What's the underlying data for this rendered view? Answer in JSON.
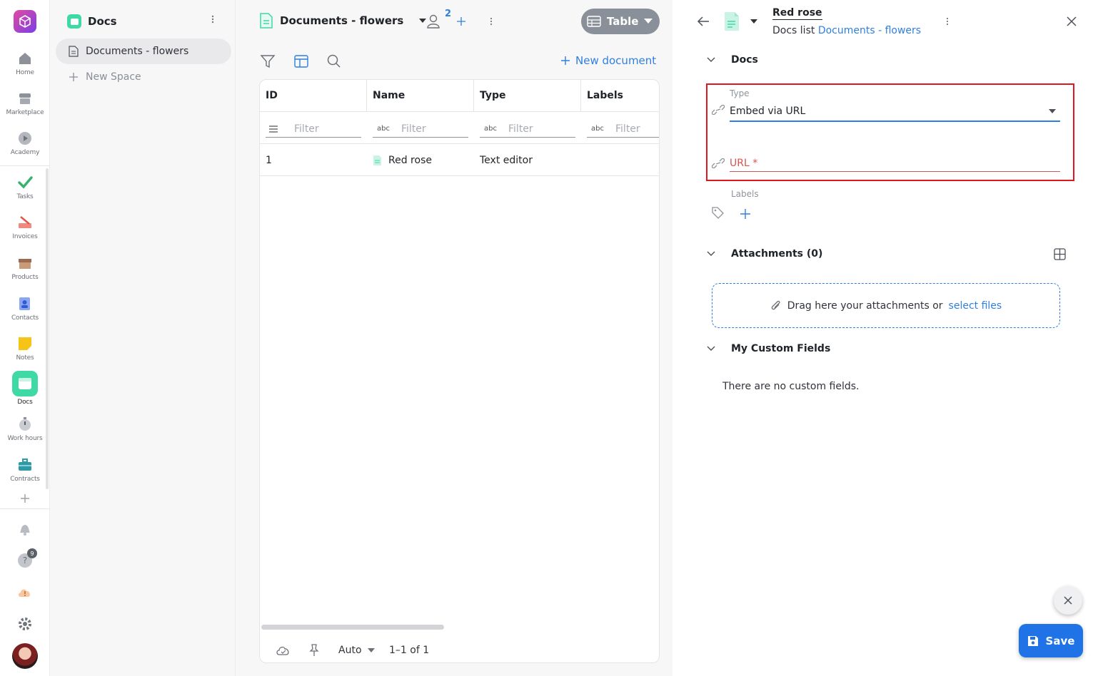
{
  "rail": {
    "items": [
      {
        "label": "Home",
        "icon": "home-icon"
      },
      {
        "label": "Marketplace",
        "icon": "store-icon"
      },
      {
        "label": "Academy",
        "icon": "play-icon"
      },
      {
        "label": "Tasks",
        "icon": "check-icon"
      },
      {
        "label": "Invoices",
        "icon": "invoice-icon"
      },
      {
        "label": "Products",
        "icon": "box-icon"
      },
      {
        "label": "Contacts",
        "icon": "contact-card-icon"
      },
      {
        "label": "Notes",
        "icon": "note-icon"
      },
      {
        "label": "Docs",
        "icon": "docs-icon"
      },
      {
        "label": "Work hours",
        "icon": "stopwatch-icon"
      },
      {
        "label": "Contracts",
        "icon": "briefcase-icon"
      }
    ],
    "help_badge": "9"
  },
  "spaces": {
    "title": "Docs",
    "items": [
      {
        "label": "Documents - flowers",
        "active": true
      }
    ],
    "new_space": "New Space"
  },
  "list": {
    "title": "Documents - flowers",
    "members_count": "2",
    "view_label": "Table",
    "new_document": "New document",
    "columns": [
      "ID",
      "Name",
      "Type",
      "Labels"
    ],
    "filter_placeholder": "Filter",
    "rows": [
      {
        "id": "1",
        "name": "Red rose",
        "type": "Text editor",
        "labels": ""
      }
    ],
    "footer": {
      "page_size": "Auto",
      "range": "1–1 of 1"
    }
  },
  "detail": {
    "title": "Red rose",
    "breadcrumb_prefix": "Docs list",
    "breadcrumb_link": "Documents - flowers",
    "section_docs": "Docs",
    "type_label": "Type",
    "type_value": "Embed via URL",
    "url_label": "URL *",
    "labels_label": "Labels",
    "attachments": "Attachments (0)",
    "drop_text": "Drag here your attachments or",
    "drop_link": "select files",
    "custom_fields": "My Custom Fields",
    "no_custom_fields": "There are no custom fields.",
    "save": "Save"
  },
  "colors": {
    "accent": "#2f7fe0",
    "highlight": "#e0171f",
    "docs_green": "#3fd9a6",
    "save_blue": "#1f73e6"
  }
}
